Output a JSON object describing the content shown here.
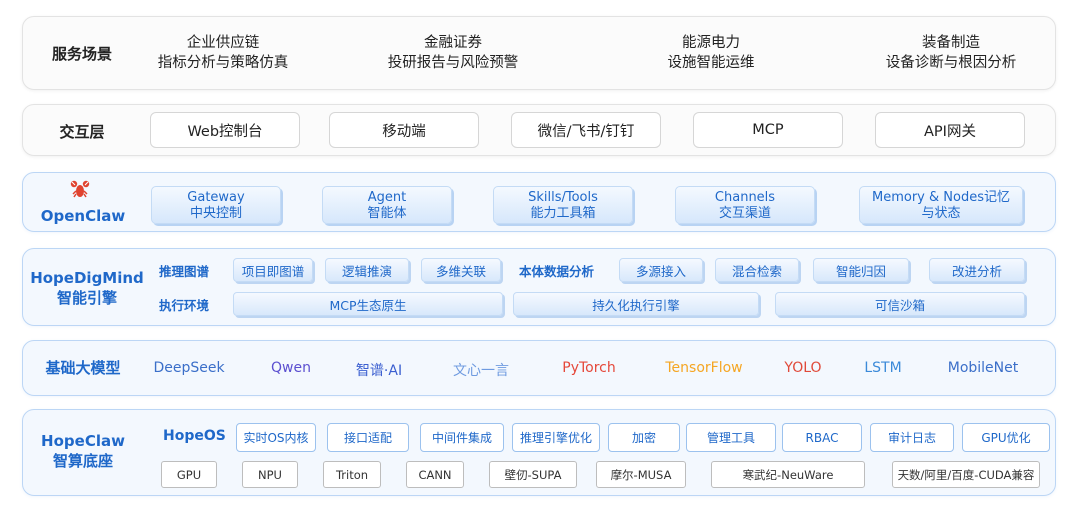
{
  "scenarios": {
    "title": "服务场景",
    "items": [
      {
        "line1": "企业供应链",
        "line2": "指标分析与策略仿真"
      },
      {
        "line1": "金融证券",
        "line2": "投研报告与风险预警"
      },
      {
        "line1": "能源电力",
        "line2": "设施智能运维"
      },
      {
        "line1": "装备制造",
        "line2": "设备诊断与根因分析"
      }
    ]
  },
  "interaction": {
    "title": "交互层",
    "items": [
      "Web控制台",
      "移动端",
      "微信/飞书/钉钉",
      "MCP",
      "API网关"
    ]
  },
  "openclaw": {
    "logo_text": "OpenClaw",
    "logo_icon": "lobster-icon",
    "items": [
      {
        "line1": "Gateway",
        "line2": "中央控制"
      },
      {
        "line1": "Agent",
        "line2": "智能体"
      },
      {
        "line1": "Skills/Tools",
        "line2": "能力工具箱"
      },
      {
        "line1": "Channels",
        "line2": "交互渠道"
      },
      {
        "line1": "Memory & Nodes记忆",
        "line2": "与状态"
      }
    ]
  },
  "hopedigmind": {
    "title_line1": "HopeDigMind",
    "title_line2": "智能引擎",
    "reasoning_label": "推理图谱",
    "reasoning_items": [
      "项目即图谱",
      "逻辑推演",
      "多维关联"
    ],
    "ontology_label": "本体数据分析",
    "ontology_items": [
      "多源接入",
      "混合检索",
      "智能归因",
      "改进分析"
    ],
    "exec_label": "执行环境",
    "exec_items": [
      "MCP生态原生",
      "持久化执行引擎",
      "可信沙箱"
    ]
  },
  "models": {
    "title": "基础大模型",
    "items": [
      {
        "name": "DeepSeek",
        "color": "#3b6fc9"
      },
      {
        "name": "Qwen",
        "color": "#5b4fd0"
      },
      {
        "name": "智谱·AI",
        "color": "#3b5fd0"
      },
      {
        "name": "文心一言",
        "color": "#6f9be0"
      },
      {
        "name": "PyTorch",
        "color": "#e5483a"
      },
      {
        "name": "TensorFlow",
        "color": "#f5a623"
      },
      {
        "name": "YOLO",
        "color": "#e04a3a"
      },
      {
        "name": "LSTM",
        "color": "#3b8ad9"
      },
      {
        "name": "MobileNet",
        "color": "#3b6fc9"
      }
    ]
  },
  "hopeclaw": {
    "title_line1": "HopeClaw",
    "title_line2": "智算底座",
    "os_label": "HopeOS",
    "os_items": [
      "实时OS内核",
      "接口适配",
      "中间件集成",
      "推理引擎优化",
      "加密",
      "管理工具",
      "RBAC",
      "审计日志",
      "GPU优化"
    ],
    "hw_items": [
      "GPU",
      "NPU",
      "Triton",
      "CANN",
      "壁仞-SUPA",
      "摩尔-MUSA",
      "寒武纪-NeuWare",
      "天数/阿里/百度-CUDA兼容"
    ]
  }
}
